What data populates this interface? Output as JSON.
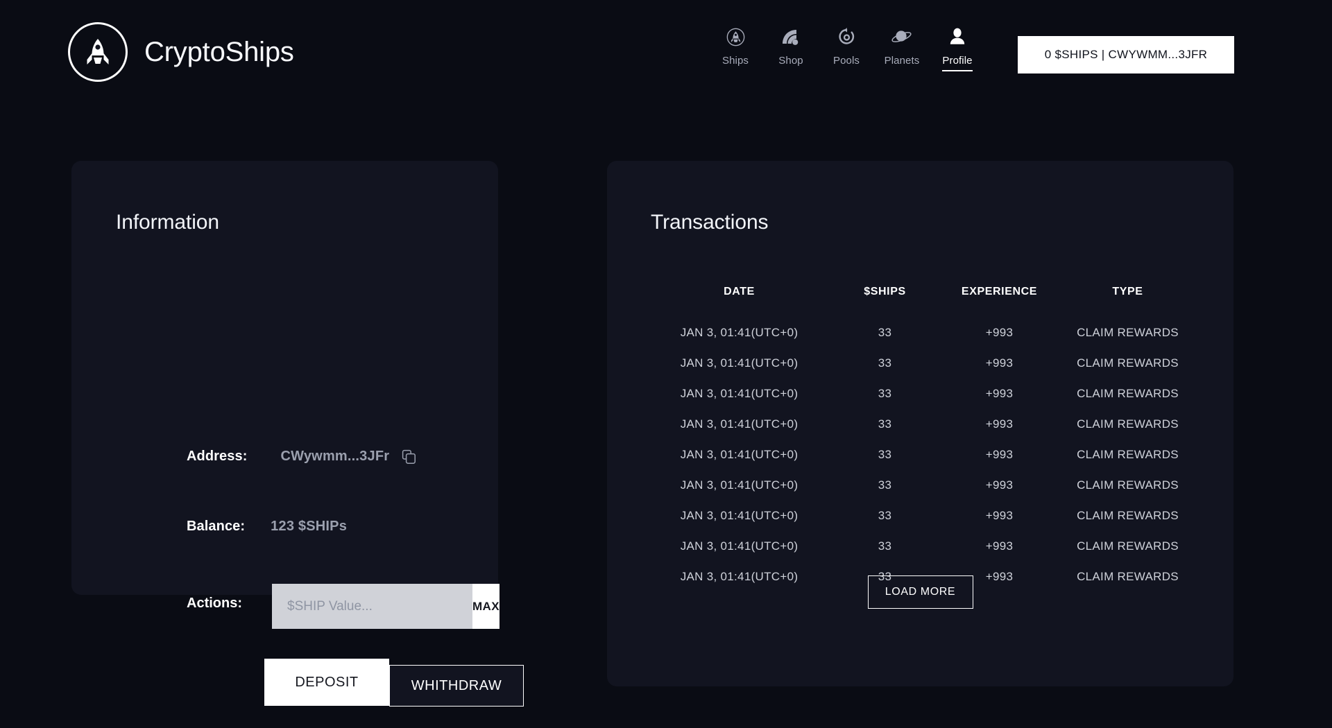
{
  "header": {
    "brand_name": "CryptoShips",
    "logo_icon": "rocket-in-circle-icon",
    "nav": [
      {
        "label": "Ships",
        "icon": "rocket-circle-icon",
        "active": false
      },
      {
        "label": "Shop",
        "icon": "signal-wifi-icon",
        "active": false
      },
      {
        "label": "Pools",
        "icon": "refresh-cycle-icon",
        "active": false
      },
      {
        "label": "Planets",
        "icon": "planet-ring-icon",
        "active": false
      },
      {
        "label": "Profile",
        "icon": "person-icon",
        "active": true
      }
    ],
    "wallet_button": "0 $SHIPS | CWYWMM...3JFR"
  },
  "information": {
    "title": "Information",
    "address_label": "Address:",
    "address_value": "CWywmm...3JFr",
    "copy_icon": "copy-icon",
    "balance_label": "Balance:",
    "balance_value": "123 $SHIPs",
    "actions_label": "Actions:",
    "input_placeholder": "$SHIP Value...",
    "input_value": "",
    "max_label": "MAX",
    "deposit_label": "DEPOSIT",
    "withdraw_label": "WHITHDRAW"
  },
  "transactions": {
    "title": "Transactions",
    "columns": [
      "DATE",
      "$SHIPS",
      "EXPERIENCE",
      "TYPE"
    ],
    "rows": [
      {
        "date": "JAN 3, 01:41(UTC+0)",
        "ships": "33",
        "experience": "+993",
        "type": "CLAIM REWARDS"
      },
      {
        "date": "JAN 3, 01:41(UTC+0)",
        "ships": "33",
        "experience": "+993",
        "type": "CLAIM REWARDS"
      },
      {
        "date": "JAN 3, 01:41(UTC+0)",
        "ships": "33",
        "experience": "+993",
        "type": "CLAIM REWARDS"
      },
      {
        "date": "JAN 3, 01:41(UTC+0)",
        "ships": "33",
        "experience": "+993",
        "type": "CLAIM REWARDS"
      },
      {
        "date": "JAN 3, 01:41(UTC+0)",
        "ships": "33",
        "experience": "+993",
        "type": "CLAIM REWARDS"
      },
      {
        "date": "JAN 3, 01:41(UTC+0)",
        "ships": "33",
        "experience": "+993",
        "type": "CLAIM REWARDS"
      },
      {
        "date": "JAN 3, 01:41(UTC+0)",
        "ships": "33",
        "experience": "+993",
        "type": "CLAIM REWARDS"
      },
      {
        "date": "JAN 3, 01:41(UTC+0)",
        "ships": "33",
        "experience": "+993",
        "type": "CLAIM REWARDS"
      },
      {
        "date": "JAN 3, 01:41(UTC+0)",
        "ships": "33",
        "experience": "+993",
        "type": "CLAIM REWARDS"
      }
    ],
    "load_more_label": "LOAD MORE"
  },
  "colors": {
    "page_background": "#0a0c14",
    "panel_background": "#121420",
    "accent_white": "#ffffff",
    "muted_text": "#9ba0ae",
    "input_background": "#d0d2d8"
  }
}
